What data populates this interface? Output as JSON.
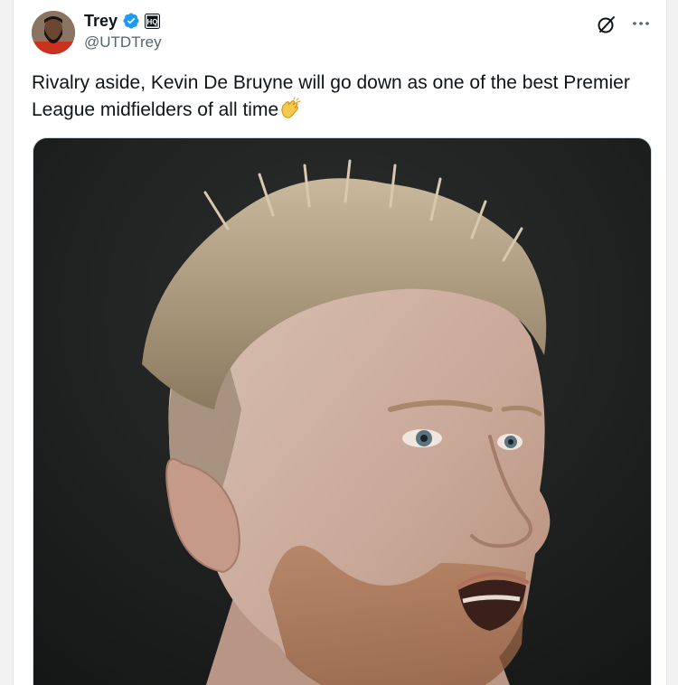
{
  "tweet": {
    "author": {
      "display_name": "Trey",
      "handle": "@UTDTrey",
      "verified": true,
      "affiliation_badge": "HQ"
    },
    "text": "Rivalry aside, Kevin De Bruyne will go down as one of the best Premier League midfielders of all time",
    "emoji": "clapping-hands-icon",
    "media": {
      "type": "photo",
      "subject": "portrait-photo"
    }
  },
  "icons": {
    "verified": "verified-badge-icon",
    "affiliation": "affiliate-badge-icon",
    "grok": "grok-icon",
    "more": "more-options-icon"
  },
  "colors": {
    "verified_blue": "#1d9bf0",
    "text_primary": "#0f1419",
    "text_secondary": "#536471",
    "photo_background": "#1d1f1f"
  }
}
